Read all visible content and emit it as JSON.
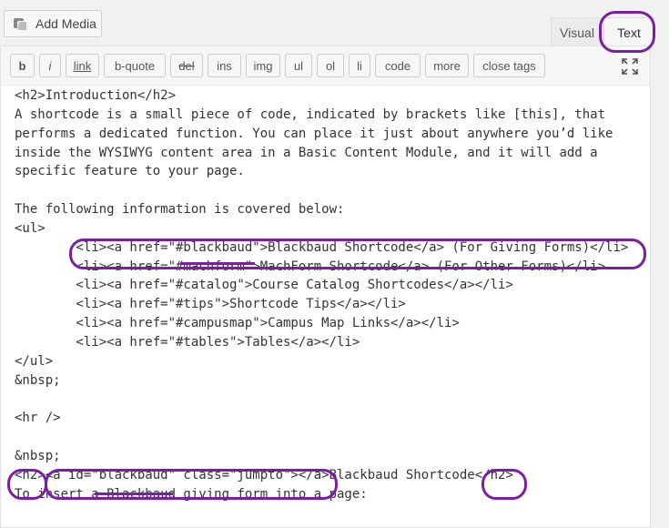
{
  "add_media": {
    "label": "Add Media",
    "icon": "add-media-icon"
  },
  "tabs": {
    "visual": "Visual",
    "text": "Text"
  },
  "toolbar": {
    "buttons": [
      "b",
      "i",
      "link",
      "b-quote",
      "del",
      "ins",
      "img",
      "ul",
      "ol",
      "li",
      "code",
      "more",
      "close tags"
    ],
    "fullscreen_icon": "fullscreen-icon"
  },
  "content": {
    "lines": [
      "<h2>Introduction</h2>",
      "A shortcode is a small piece of code, indicated by brackets like [this], that",
      "performs a dedicated function. You can place it just about anywhere you’d like",
      "inside the WYSIWYG content area in a Basic Content Module, and it will add a",
      "specific feature to your page.",
      "",
      "The following information is covered below:",
      "<ul>",
      "        <li><a href=\"#blackbaud\">Blackbaud Shortcode</a> (For Giving Forms)</li>",
      "        <li><a href=\"#machform\">MachForm Shortcode</a> (For Other Forms)</li>",
      "        <li><a href=\"#catalog\">Course Catalog Shortcodes</a></li>",
      "        <li><a href=\"#tips\">Shortcode Tips</a></li>",
      "        <li><a href=\"#campusmap\">Campus Map Links</a></li>",
      "        <li><a href=\"#tables\">Tables</a></li>",
      "</ul>",
      "&nbsp;",
      "",
      "<hr />",
      "",
      "&nbsp;",
      "<h2><a id=\"blackbaud\" class=\"jumpto\"></a>Blackbaud Shortcode</h2>",
      "To insert a Blackbaud giving form into a page:"
    ]
  },
  "annotation_color": "#7a1fa2"
}
